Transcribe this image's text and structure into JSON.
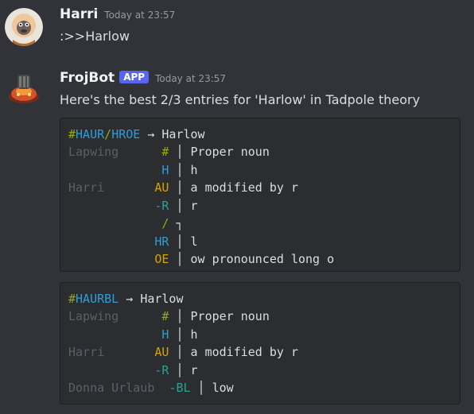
{
  "message1": {
    "username": "Harri",
    "timestamp": "Today at 23:57",
    "text": ":>>Harlow"
  },
  "message2": {
    "username": "FrojBot",
    "badge": "APP",
    "timestamp": "Today at 23:57",
    "text": "Here's the best 2/3 entries for 'Harlow' in Tadpole theory"
  },
  "entry1": {
    "hdr": {
      "hash": "#",
      "s1": "HAUR",
      "slash": "/",
      "s2": "HROE",
      "arrow": " → ",
      "word": "Harlow"
    },
    "rows": [
      {
        "who": "Lapwing     ",
        "stroke": " #",
        "bar": " │ ",
        "desc": "Proper noun"
      },
      {
        "who": "            ",
        "stroke": " H",
        "bar": " │ ",
        "desc": "h"
      },
      {
        "who": "Harri       ",
        "stroke": "AU",
        "bar": " │ ",
        "desc": "a modified by r"
      },
      {
        "who": "            ",
        "stroke": "-R",
        "bar": " │ ",
        "desc": "r"
      },
      {
        "who": "            ",
        "stroke": " /",
        "bar": " ┐",
        "desc": ""
      },
      {
        "who": "            ",
        "stroke": "HR",
        "bar": " │ ",
        "desc": "l"
      },
      {
        "who": "            ",
        "stroke": "OE",
        "bar": " │ ",
        "desc": "ow pronounced long o"
      }
    ]
  },
  "entry2": {
    "hdr": {
      "hash": "#",
      "s1": "HAURBL",
      "arrow": " → ",
      "word": "Harlow"
    },
    "rows": [
      {
        "who": "Lapwing     ",
        "stroke": " #",
        "bar": " │ ",
        "desc": "Proper noun"
      },
      {
        "who": "            ",
        "stroke": " H",
        "bar": " │ ",
        "desc": "h"
      },
      {
        "who": "Harri       ",
        "stroke": "AU",
        "bar": " │ ",
        "desc": "a modified by r"
      },
      {
        "who": "            ",
        "stroke": "-R",
        "bar": " │ ",
        "desc": "r"
      },
      {
        "who": "Donna Urlaub  ",
        "stroke": "-BL",
        "bar": " │ ",
        "desc": "low"
      }
    ]
  },
  "colors": {
    "background": "#313338",
    "codeblock": "#2b2d31",
    "app_badge": "#5865f2",
    "stroke_hash": "#9aa90f",
    "stroke_h": "#2f9ed6",
    "stroke_vowel": "#d7a300",
    "stroke_right": "#2aa198"
  }
}
